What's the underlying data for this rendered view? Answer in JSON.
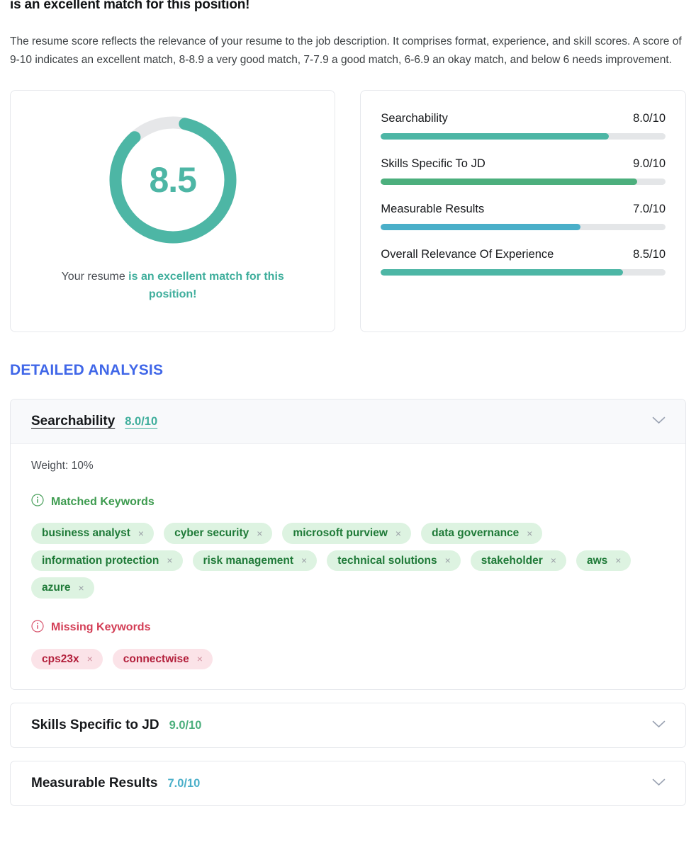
{
  "headline": "is an excellent match for this position!",
  "intro": "The resume score reflects the relevance of your resume to the job description. It comprises format, experience, and skill scores. A score of 9-10 indicates an excellent match, 8-8.9 a very good match, 7-7.9 a good match, 6-6.9 an okay match, and below 6 needs improvement.",
  "gauge": {
    "value": "8.5",
    "max": 10,
    "percent": 85,
    "color": "#4db6a5",
    "track_color": "#e4e6e8",
    "caption_prefix": "Your resume ",
    "caption_highlight": "is an excellent match for this position!"
  },
  "chart_data": {
    "type": "bar",
    "title": "Resume sub-scores",
    "orientation": "horizontal",
    "categories": [
      "Searchability",
      "Skills Specific To JD",
      "Measurable Results",
      "Overall Relevance Of Experience"
    ],
    "values": [
      8.0,
      9.0,
      7.0,
      8.5
    ],
    "value_labels": [
      "8.0/10",
      "9.0/10",
      "7.0/10",
      "8.5/10"
    ],
    "colors": [
      "#4db6a5",
      "#4caf7d",
      "#4aafc9",
      "#4db6a5"
    ],
    "xlabel": "",
    "ylabel": "",
    "xlim": [
      0,
      10
    ],
    "grid": false,
    "legend": "none"
  },
  "scores": [
    {
      "label": "Searchability",
      "score_text": "8.0/10",
      "percent": 80,
      "color": "#4db6a5"
    },
    {
      "label": "Skills Specific To JD",
      "score_text": "9.0/10",
      "percent": 90,
      "color": "#4caf7d"
    },
    {
      "label": "Measurable Results",
      "score_text": "7.0/10",
      "percent": 70,
      "color": "#4aafc9"
    },
    {
      "label": "Overall Relevance Of Experience",
      "score_text": "8.5/10",
      "percent": 85,
      "color": "#4db6a5"
    }
  ],
  "detailed_analysis": {
    "heading": "DETAILED ANALYSIS",
    "heading_color": "#4067e8",
    "sections": [
      {
        "title": "Searchability",
        "score_text": "8.0/10",
        "score_color": "#3fae9c",
        "expanded": true,
        "weight_text": "Weight: 10%",
        "matched_label": "Matched Keywords",
        "missing_label": "Missing Keywords",
        "matched_keywords": [
          "business analyst",
          "cyber security",
          "microsoft purview",
          "data governance",
          "information protection",
          "risk management",
          "technical solutions",
          "stakeholder",
          "aws",
          "azure"
        ],
        "missing_keywords": [
          "cps23x",
          "connectwise"
        ],
        "remove_symbol": "×"
      },
      {
        "title": "Skills Specific to JD",
        "score_text": "9.0/10",
        "score_color": "#4caf7d",
        "expanded": false
      },
      {
        "title": "Measurable Results",
        "score_text": "7.0/10",
        "score_color": "#4aafc9",
        "expanded": false
      }
    ]
  }
}
